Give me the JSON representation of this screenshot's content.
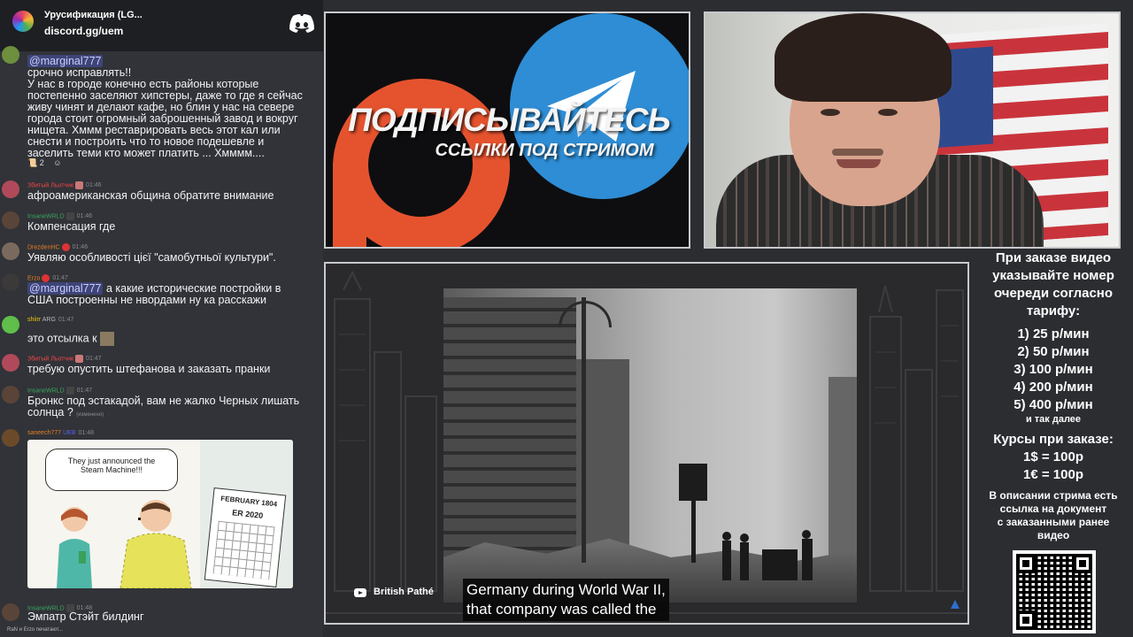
{
  "chat": {
    "server_name": "Урусификация (LG...",
    "server_link": "discord.gg/uem",
    "big_message": {
      "mention": "@marginal777",
      "lines": [
        "срочно исправлять!!",
        "У нас в городе конечно есть районы которые",
        "постепенно заселяют хипстеры, даже то где я сейчас",
        "живу чинят и делают кафе, но блин у нас на севере",
        "города стоит огромный заброшенный завод и вокруг",
        "нищета. Хммм реставрировать весь этот кал или",
        "снести и построить что то  новое подешевле и",
        "заселить теми кто может платить ... Хмммм...."
      ],
      "reaction_count": "2"
    },
    "messages": [
      {
        "user": "Збитый Льотчик",
        "time": "01:46",
        "user_color": "#f04747",
        "text": "афроамериканская община обратите внимание"
      },
      {
        "user": "InsaneWRLD",
        "time": "01:46",
        "user_color": "#3ba55d",
        "text": "Компенсация где"
      },
      {
        "user": "DrezdenHC",
        "time": "01:46",
        "user_color": "#e67e22",
        "text": "Уявляю особливості цієї \"самобутньої культури\"."
      },
      {
        "user": "Erzo",
        "time": "01:47",
        "user_color": "#e67e22",
        "mention": "@marginal777",
        "text": " а какие исторические постройки в",
        "text2": "США построенны не нвордами ну ка расскажи"
      },
      {
        "user": "shiirr",
        "time": "01:47",
        "user_color": "#f1c40f",
        "tag": "ARG",
        "text": "это отсылка к"
      },
      {
        "user": "Збитый Льотчик",
        "time": "01:47",
        "user_color": "#f04747",
        "text": "требую опустить штефанова и заказать пранки"
      },
      {
        "user": "InsaneWRLD",
        "time": "01:47",
        "user_color": "#3ba55d",
        "text": "Бронкс под эстакадой, вам не жалко Черных лишать",
        "text2": "солнца ?",
        "edited": "(изменено)"
      },
      {
        "user": "saneech777",
        "time": "01:48",
        "user_color": "#e67e22",
        "tag": "UEB"
      },
      {
        "user": "InsaneWRLD",
        "time": "01:48",
        "user_color": "#3ba55d",
        "text": "Эмпатр Стэйт билдинг"
      }
    ],
    "comic": {
      "bubble_line1": "They just announced the",
      "bubble_line2": "Steam Machine!!!",
      "calendar_top": "FEBRUARY 1804",
      "calendar_bottom": "ER 2020"
    },
    "typing": "RaN и Erzo печатают..."
  },
  "promo": {
    "title": "ПОДПИСЫВАЙТЕСЬ",
    "subtitle": "ССЫЛКИ ПОД СТРИМОМ"
  },
  "video": {
    "channel": "British Pathé",
    "caption_line1": "Germany during World War II,",
    "caption_line2": "that company was called the"
  },
  "info": {
    "heading": [
      "При заказе видео",
      "указывайте номер",
      "очереди согласно",
      "тарифу:"
    ],
    "tariffs": [
      "1) 25 р/мин",
      "2) 50 р/мин",
      "3) 100 р/мин",
      "4) 200 р/мин",
      "5) 400 р/мин"
    ],
    "etc": "и так далее",
    "rates_title": "Курсы при заказе:",
    "rates": [
      "1$ = 100р",
      "1€ = 100р"
    ],
    "note": [
      "В описании стрима есть",
      "ссылка на документ",
      "с заказанными ранее",
      "видео"
    ]
  },
  "colors": {
    "discord_bg": "#313338",
    "patreon": "#e5532e",
    "telegram": "#2e8dd5",
    "mention_bg": "#5865f2"
  }
}
